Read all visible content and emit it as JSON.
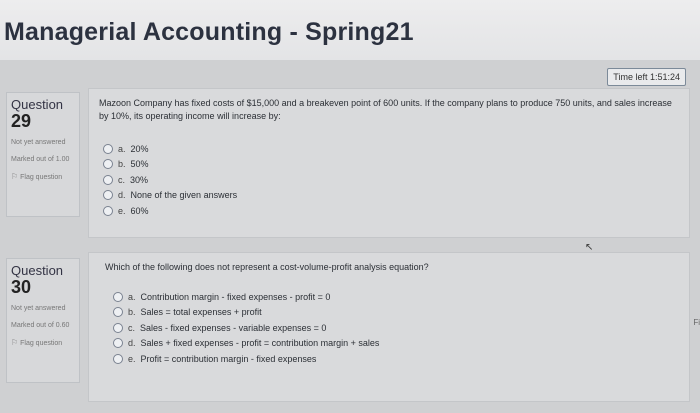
{
  "page": {
    "title": "Managerial Accounting - Spring21"
  },
  "timer": {
    "label": "Time left 1:51:24"
  },
  "questions": [
    {
      "label": "Question",
      "number": "29",
      "status": "Not yet answered",
      "marks": "Marked out of 1.00",
      "flag": "Flag question",
      "text": "Mazoon Company has fixed costs of $15,000 and a breakeven point of 600 units. If the company plans to produce 750 units, and sales increase by 10%, its operating income will increase by:",
      "answers": [
        {
          "letter": "a.",
          "text": "20%"
        },
        {
          "letter": "b.",
          "text": "50%"
        },
        {
          "letter": "c.",
          "text": "30%"
        },
        {
          "letter": "d.",
          "text": "None of the given answers"
        },
        {
          "letter": "e.",
          "text": "60%"
        }
      ]
    },
    {
      "label": "Question",
      "number": "30",
      "status": "Not yet answered",
      "marks": "Marked out of 0.60",
      "flag": "Flag question",
      "text": "Which of the following does not represent a cost-volume-profit analysis equation?",
      "answers": [
        {
          "letter": "a.",
          "text": "Contribution margin - fixed expenses - profit = 0"
        },
        {
          "letter": "b.",
          "text": "Sales = total expenses + profit"
        },
        {
          "letter": "c.",
          "text": "Sales - fixed expenses - variable expenses = 0"
        },
        {
          "letter": "d.",
          "text": "Sales + fixed expenses - profit = contribution margin + sales"
        },
        {
          "letter": "e.",
          "text": "Profit = contribution margin - fixed expenses"
        }
      ]
    }
  ],
  "edge_text": "Fi"
}
